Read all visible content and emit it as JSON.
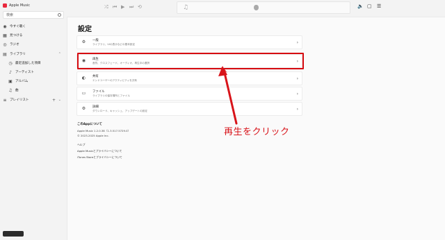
{
  "app": {
    "name": "Apple Music"
  },
  "search": {
    "placeholder": "検索"
  },
  "sidebar": {
    "items": [
      {
        "label": "今すぐ聴く",
        "icon": "play-circle-icon"
      },
      {
        "label": "見つける",
        "icon": "grid-icon"
      },
      {
        "label": "ラジオ",
        "icon": "radio-icon"
      }
    ],
    "library": {
      "label": "ライブラリ"
    },
    "library_items": [
      {
        "label": "最近追加した項目"
      },
      {
        "label": "アーティスト"
      },
      {
        "label": "アルバム"
      },
      {
        "label": "曲"
      }
    ],
    "playlists": {
      "label": "プレイリスト"
    }
  },
  "settings": {
    "title": "設定",
    "cards": [
      {
        "title": "一般",
        "desc": "ライブラリ、UIの表示などの基本設定",
        "icon": "gear-icon"
      },
      {
        "title": "再生",
        "desc": "音質、クロスフェード、オーディオ、再生中の選択",
        "icon": "play-icon"
      },
      {
        "title": "共有",
        "desc": "エンドユーザーのアクティビティを共有",
        "icon": "share-icon"
      },
      {
        "title": "ファイル",
        "desc": "ライブラリの保存場所とファイル",
        "icon": "folder-icon"
      },
      {
        "title": "詳細",
        "desc": "ダウンロード、キャッシュ、アップデートの設定",
        "icon": "advanced-gear-icon"
      }
    ]
  },
  "about": {
    "heading": "このAppについて",
    "version": "Apple Music 1.2.0.38（1.3.517.5729.0）",
    "copyright": "© 2023-2025 Apple Inc.",
    "help": "ヘルプ",
    "link1": "Apple Musicとプライバシーについて",
    "link2": "iTunes Storeとプライバシーについて"
  },
  "annotation": {
    "text": "再生をクリック",
    "color": "#d8141a"
  }
}
